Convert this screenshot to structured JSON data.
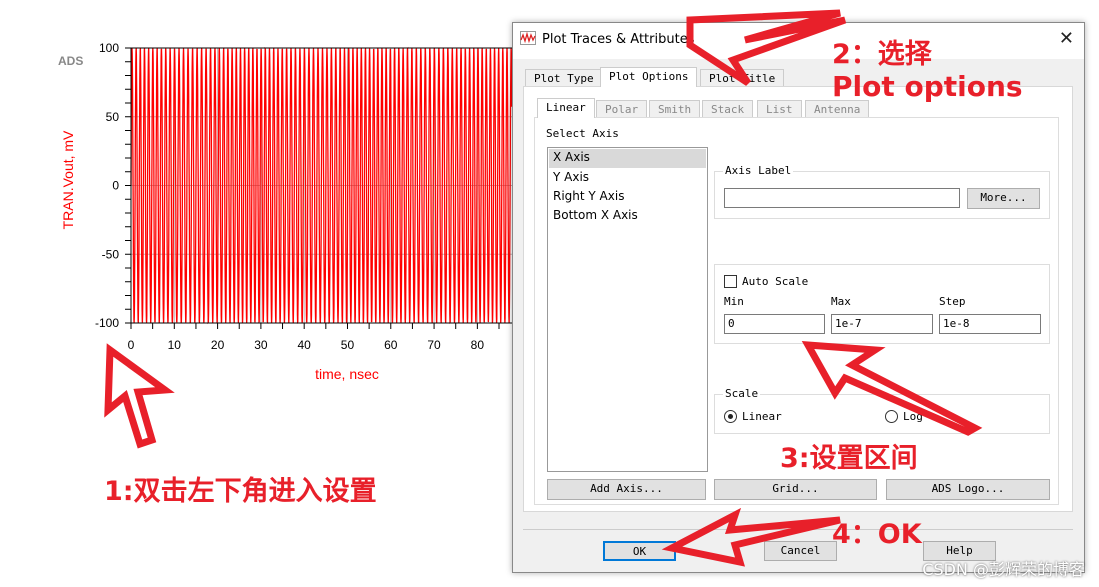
{
  "chart_data": {
    "type": "line",
    "watermark": "ADS",
    "xlabel": "time, nsec",
    "ylabel": "TRAN.Vout, mV",
    "xlim": [
      0,
      88
    ],
    "ylim": [
      -100,
      100
    ],
    "xticks": [
      "0",
      "10",
      "20",
      "30",
      "40",
      "50",
      "60",
      "70",
      "80"
    ],
    "yticks": [
      "100",
      "50",
      "0",
      "-50",
      "-100"
    ],
    "grid": true,
    "series": [
      {
        "color": "#ff0000",
        "amplitude": 100
      }
    ]
  },
  "dialog": {
    "title": "Plot Traces & Attributes",
    "tabs": [
      "Plot Type",
      "Plot Options",
      "Plot Title"
    ],
    "active_tab": "Plot Options",
    "subtabs": [
      "Linear",
      "Polar",
      "Smith",
      "Stack",
      "List",
      "Antenna"
    ],
    "select_axis_label": "Select Axis",
    "axes": [
      "X Axis",
      "Y Axis",
      "Right Y Axis",
      "Bottom X Axis"
    ],
    "selected_axis": "X Axis",
    "axis_label_group": "Axis Label",
    "axis_label_value": "",
    "more_button": "More...",
    "auto_scale": "Auto Scale",
    "auto_scale_checked": false,
    "min_label": "Min",
    "max_label": "Max",
    "step_label": "Step",
    "min_value": "0",
    "max_value": "1e-7",
    "step_value": "1e-8",
    "scale_group": "Scale",
    "scale_linear": "Linear",
    "scale_log": "Log",
    "scale_selected": "Linear",
    "add_axis": "Add Axis...",
    "grid": "Grid...",
    "ads_logo": "ADS Logo...",
    "ok": "OK",
    "cancel": "Cancel",
    "help": "Help"
  },
  "annotations": {
    "step1": "1:双击左下角进入设置",
    "step2a": "2：选择",
    "step2b": "Plot options",
    "step3": "3:设置区间",
    "step4": "4：OK",
    "colors": {
      "annotation": "#e8202a"
    }
  },
  "watermark": "CSDN @彭辉荣的博客"
}
